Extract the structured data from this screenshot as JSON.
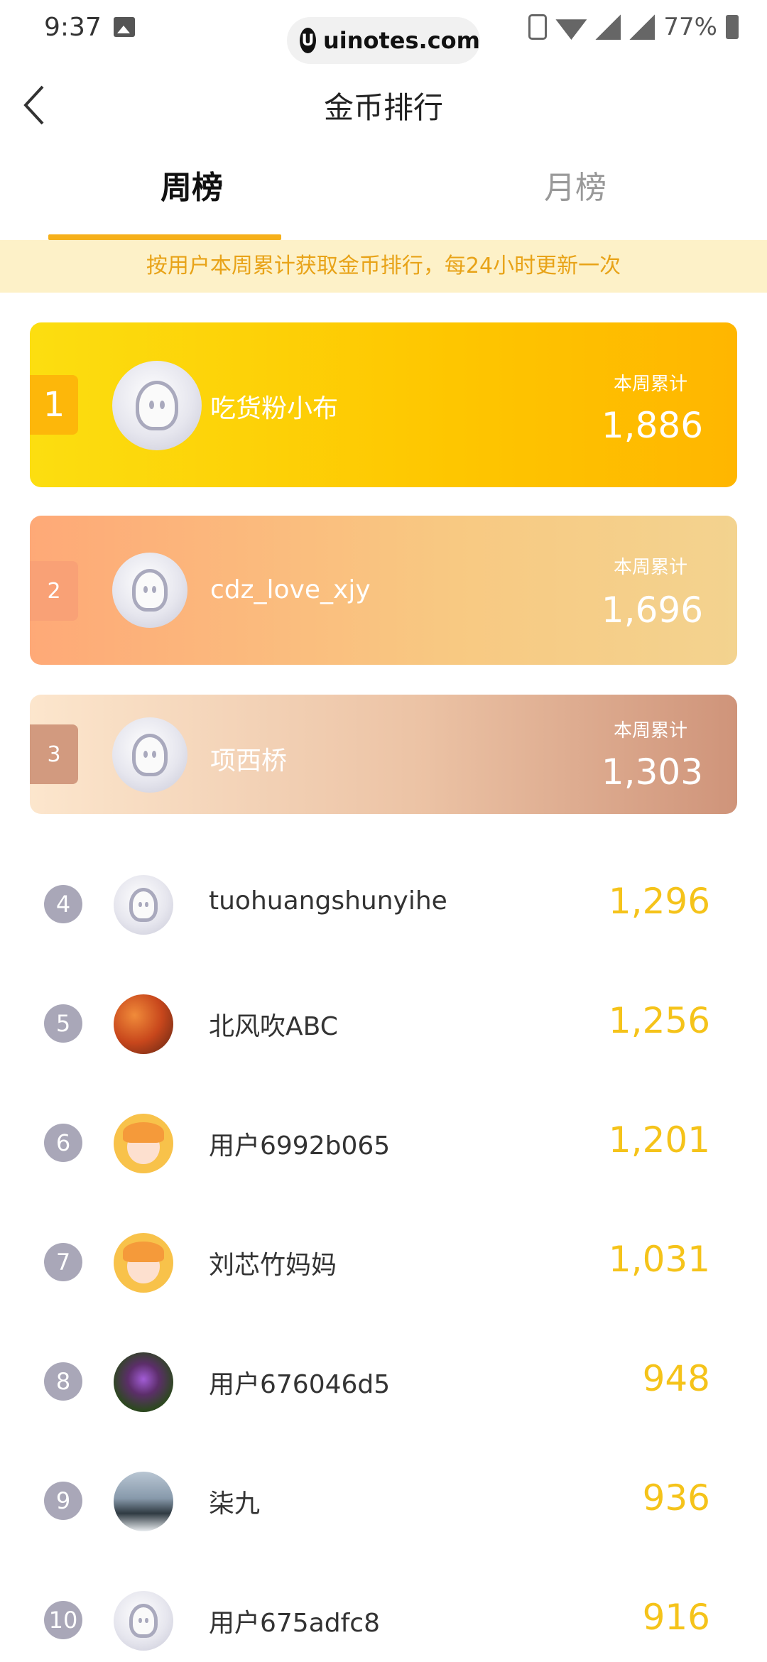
{
  "status_bar": {
    "time": "9:37",
    "watermark": "uinotes.com",
    "watermark_logo": "U",
    "battery": "77%",
    "icons": [
      "image-icon",
      "vibrate-icon",
      "wifi-icon",
      "signal-icon",
      "signal-icon",
      "battery-icon"
    ]
  },
  "nav": {
    "title": "金币排行",
    "back_icon": "chevron-left-icon"
  },
  "tabs": [
    {
      "label": "周榜",
      "active": true
    },
    {
      "label": "月榜",
      "active": false
    }
  ],
  "notice": "按用户本周累计获取金币排行，每24小时更新一次",
  "top_ranks": [
    {
      "rank": "1",
      "name": "吃货粉小布",
      "label": "本周累计",
      "coins": "1,886",
      "avatar": "default-ghost-avatar"
    },
    {
      "rank": "2",
      "name": "cdz_love_xjy",
      "label": "本周累计",
      "coins": "1,696",
      "avatar": "default-ghost-avatar"
    },
    {
      "rank": "3",
      "name": "项西桥",
      "label": "本周累计",
      "coins": "1,303",
      "avatar": "default-ghost-avatar"
    }
  ],
  "ranks": [
    {
      "rank": "4",
      "name": "tuohuangshunyihe",
      "coins": "1,296",
      "avatar": "default-ghost-avatar"
    },
    {
      "rank": "5",
      "name": "北风吹ABC",
      "coins": "1,256",
      "avatar": "guitar-photo-avatar"
    },
    {
      "rank": "6",
      "name": "用户6992b065",
      "coins": "1,201",
      "avatar": "cartoon-girl-avatar"
    },
    {
      "rank": "7",
      "name": "刘芯竹妈妈",
      "coins": "1,031",
      "avatar": "cartoon-girl-avatar"
    },
    {
      "rank": "8",
      "name": "用户676046d5",
      "coins": "948",
      "avatar": "flower-photo-avatar"
    },
    {
      "rank": "9",
      "name": "柒九",
      "coins": "936",
      "avatar": "landscape-photo-avatar"
    },
    {
      "rank": "10",
      "name": "用户675adfc8",
      "coins": "916",
      "avatar": "default-ghost-avatar"
    }
  ],
  "colors": {
    "accent": "#f6b01a",
    "score": "#f5c31a",
    "notice_bg": "#fdf1c8",
    "notice_text": "#e8a318",
    "rank_circle": "#a9a7b8"
  }
}
